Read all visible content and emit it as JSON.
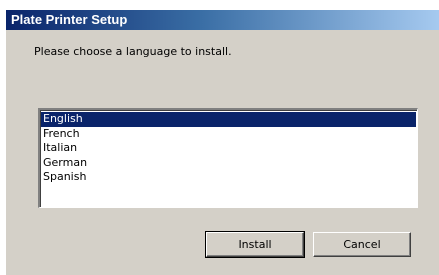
{
  "window": {
    "title": "Plate Printer Setup"
  },
  "dialog": {
    "prompt": "Please choose a language to install."
  },
  "language_list": {
    "items": [
      {
        "label": "English",
        "selected": true
      },
      {
        "label": "French",
        "selected": false
      },
      {
        "label": "Italian",
        "selected": false
      },
      {
        "label": "German",
        "selected": false
      },
      {
        "label": "Spanish",
        "selected": false
      }
    ]
  },
  "buttons": {
    "install_label": "Install",
    "cancel_label": "Cancel"
  },
  "colors": {
    "selection_bg": "#0a246a",
    "dialog_bg": "#d4d0c8"
  }
}
